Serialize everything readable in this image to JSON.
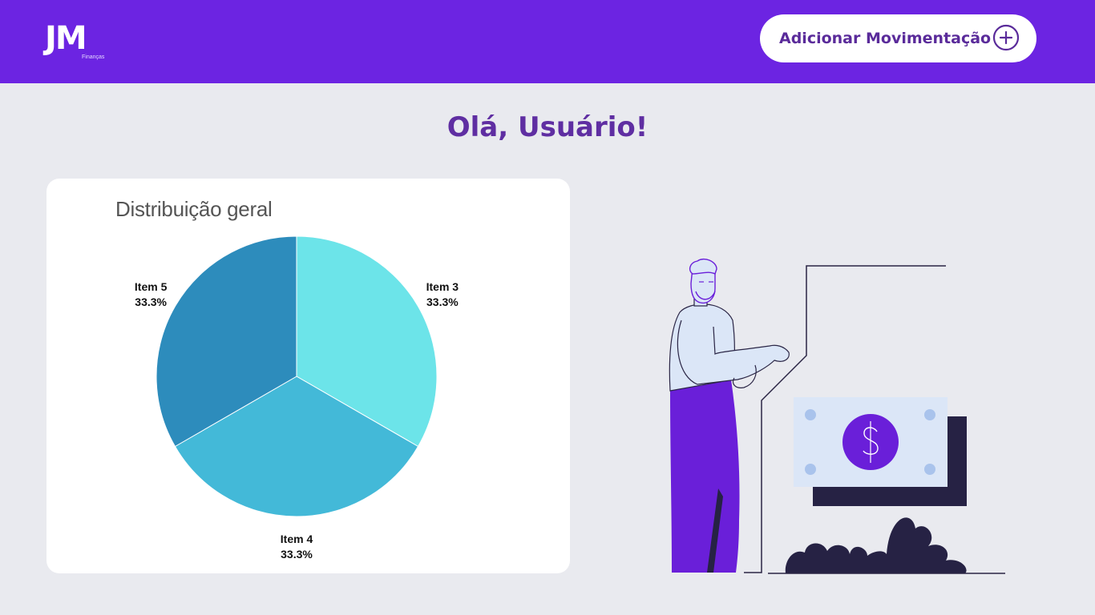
{
  "header": {
    "logo": {
      "text": "JM",
      "subtext": "Finanças"
    },
    "add_button": {
      "label": "Adicionar Movimentação",
      "icon": "plus-circle-icon"
    },
    "colors": {
      "background": "#6c24e2",
      "button_text": "#5a2b9a"
    }
  },
  "greeting": "Olá, Usuário!",
  "chart_data": {
    "type": "pie",
    "title": "Distribuição geral",
    "slices": [
      {
        "label": "Item 3",
        "value": 33.3,
        "display": "33.3%",
        "color": "#6ce4e9"
      },
      {
        "label": "Item 4",
        "value": 33.3,
        "display": "33.3%",
        "color": "#43b9d8"
      },
      {
        "label": "Item 5",
        "value": 33.3,
        "display": "33.3%",
        "color": "#2d8cbc"
      }
    ]
  },
  "illustration": {
    "icon": "person-with-money-illustration"
  }
}
